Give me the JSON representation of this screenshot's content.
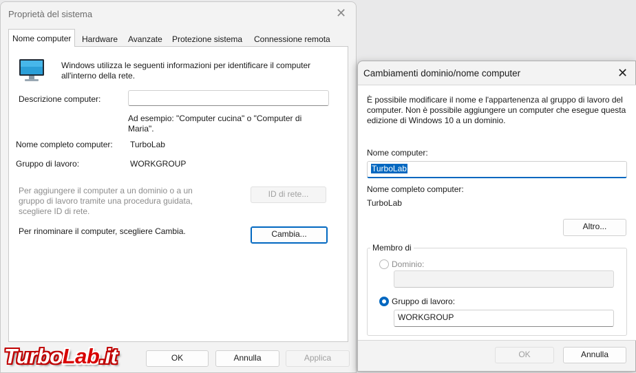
{
  "sysprops": {
    "title": "Proprietà del sistema",
    "tabs": [
      {
        "label": "Nome computer",
        "active": true
      },
      {
        "label": "Hardware",
        "active": false
      },
      {
        "label": "Avanzate",
        "active": false
      },
      {
        "label": "Protezione sistema",
        "active": false
      },
      {
        "label": "Connessione remota",
        "active": false
      }
    ],
    "intro": "Windows utilizza le seguenti informazioni per identificare il computer all'interno della rete.",
    "description_label": "Descrizione computer:",
    "description_value": "",
    "example": "Ad esempio: \"Computer cucina\" o \"Computer di Maria\".",
    "fullname_label": "Nome completo computer:",
    "fullname_value": "TurboLab",
    "workgroup_label": "Gruppo di lavoro:",
    "workgroup_value": "WORKGROUP",
    "domain_hint": "Per aggiungere il computer a un dominio o a un gruppo di lavoro tramite una procedura guidata, scegliere ID di rete.",
    "network_id_button": "ID di rete...",
    "rename_hint": "Per rinominare il computer, scegliere Cambia.",
    "change_button": "Cambia...",
    "ok_button": "OK",
    "cancel_button": "Annulla",
    "apply_button": "Applica"
  },
  "domain_dialog": {
    "title": "Cambiamenti dominio/nome computer",
    "intro": "È possibile modificare il nome e l'appartenenza al gruppo di lavoro del computer. Non è possibile aggiungere un computer che esegue questa edizione di Windows 10 a un dominio.",
    "name_label": "Nome computer:",
    "name_value": "TurboLab",
    "fullname_label": "Nome completo computer:",
    "fullname_value": "TurboLab",
    "more_button": "Altro...",
    "member_of_label": "Membro di",
    "domain_radio_label": "Dominio:",
    "domain_value": "",
    "workgroup_radio_label": "Gruppo di lavoro:",
    "workgroup_value": "WORKGROUP",
    "ok_button": "OK",
    "cancel_button": "Annulla"
  },
  "watermark": {
    "part1": "Turbo",
    "part2": "Lab",
    "part3": ".it"
  },
  "colors": {
    "accent": "#0067c0",
    "watermark_red": "#d80000"
  }
}
